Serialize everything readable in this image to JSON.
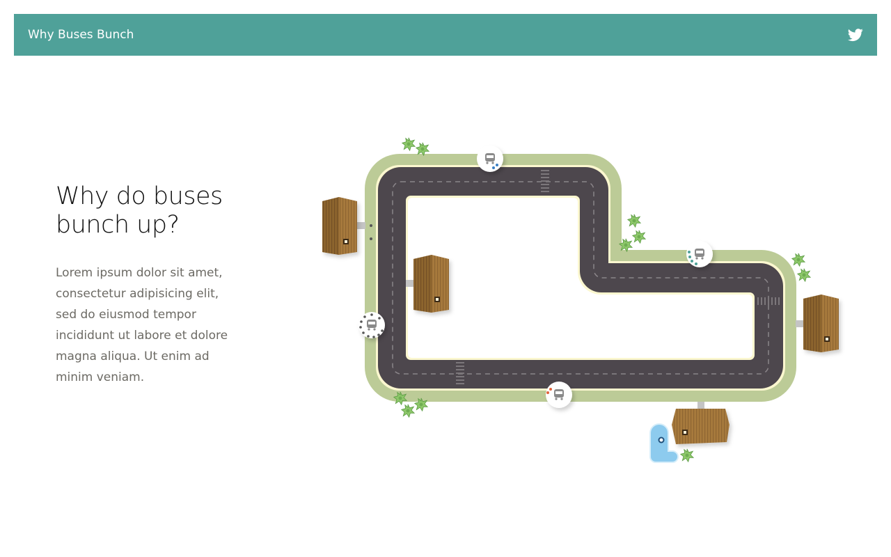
{
  "header": {
    "title": "Why Buses Bunch",
    "share_icon": "twitter-icon",
    "color": "#4fa199"
  },
  "intro": {
    "title": "Why do buses bunch up?",
    "body": "Lorem ipsum dolor sit amet, consectetur adipisicing elit, sed do eiusmod tempor incididunt ut labore et dolore magna aliqua. Ut enim ad minim veniam."
  },
  "scene": {
    "road_color": "#4d474d",
    "grass_color": "#bccb97",
    "building_color": "#a77a3e",
    "pond_color": "#8dcbee",
    "stop_icon": "bus-icon",
    "buses": [
      {
        "name": "bus-top",
        "passenger_color": "#3b7fc4"
      },
      {
        "name": "bus-right",
        "passenger_color": "#4fa199"
      },
      {
        "name": "bus-left",
        "passenger_color": "#555555"
      },
      {
        "name": "bus-bottom",
        "passenger_color": "#e2623c"
      }
    ]
  }
}
